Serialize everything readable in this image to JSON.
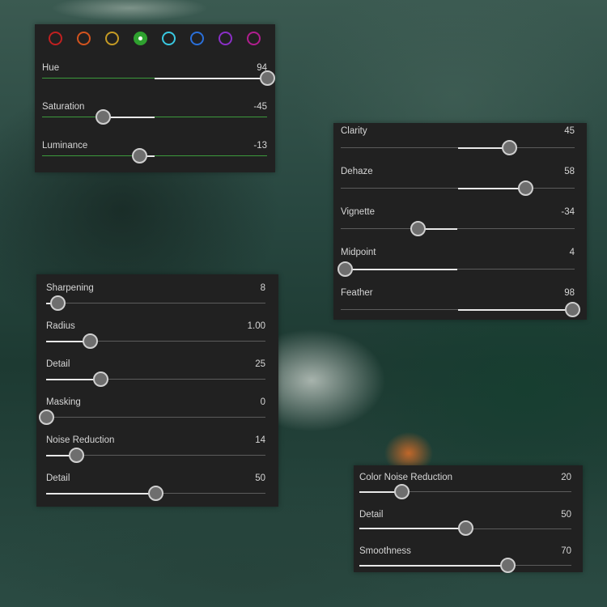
{
  "hsl_panel": {
    "swatches": [
      {
        "name": "red",
        "color": "#c02020"
      },
      {
        "name": "orange",
        "color": "#d2531e"
      },
      {
        "name": "yellow",
        "color": "#c49a24"
      },
      {
        "name": "green",
        "color": "#2fa12f",
        "selected": true
      },
      {
        "name": "aqua",
        "color": "#39c8e0"
      },
      {
        "name": "blue",
        "color": "#2a6fd8"
      },
      {
        "name": "purple",
        "color": "#8a2fc6"
      },
      {
        "name": "magenta",
        "color": "#b01e8e"
      }
    ],
    "sliders": [
      {
        "key": "hue",
        "label": "Hue",
        "value": "94",
        "pos": 1.0,
        "mode": "center",
        "accent": "#3c9a3c"
      },
      {
        "key": "saturation",
        "label": "Saturation",
        "value": "-45",
        "pos": 0.27,
        "mode": "center",
        "accent": "#3c9a3c"
      },
      {
        "key": "luminance",
        "label": "Luminance",
        "value": "-13",
        "pos": 0.435,
        "mode": "center",
        "accent": "#3c9a3c"
      }
    ]
  },
  "effects_panel": {
    "sliders": [
      {
        "key": "clarity",
        "label": "Clarity",
        "value": "45",
        "pos": 0.72,
        "mode": "center"
      },
      {
        "key": "dehaze",
        "label": "Dehaze",
        "value": "58",
        "pos": 0.79,
        "mode": "center"
      },
      {
        "key": "vignette",
        "label": "Vignette",
        "value": "-34",
        "pos": 0.33,
        "mode": "center"
      },
      {
        "key": "midpoint",
        "label": "Midpoint",
        "value": "4",
        "pos": 0.02,
        "mode": "center"
      },
      {
        "key": "feather",
        "label": "Feather",
        "value": "98",
        "pos": 0.99,
        "mode": "center"
      }
    ]
  },
  "detail_panel": {
    "sliders": [
      {
        "key": "sharpening",
        "label": "Sharpening",
        "value": "8",
        "pos": 0.055,
        "mode": "left"
      },
      {
        "key": "radius",
        "label": "Radius",
        "value": "1.00",
        "pos": 0.2,
        "mode": "left"
      },
      {
        "key": "detail",
        "label": "Detail",
        "value": "25",
        "pos": 0.25,
        "mode": "left"
      },
      {
        "key": "masking",
        "label": "Masking",
        "value": "0",
        "pos": 0.0,
        "mode": "left"
      },
      {
        "key": "noise-reduction",
        "label": "Noise Reduction",
        "value": "14",
        "pos": 0.14,
        "mode": "left"
      },
      {
        "key": "noise-detail",
        "label": "Detail",
        "value": "50",
        "pos": 0.5,
        "mode": "left"
      }
    ]
  },
  "color_noise_panel": {
    "sliders": [
      {
        "key": "color-noise-reduction",
        "label": "Color Noise Reduction",
        "value": "20",
        "pos": 0.2,
        "mode": "left"
      },
      {
        "key": "color-detail",
        "label": "Detail",
        "value": "50",
        "pos": 0.5,
        "mode": "left"
      },
      {
        "key": "smoothness",
        "label": "Smoothness",
        "value": "70",
        "pos": 0.7,
        "mode": "left"
      }
    ]
  }
}
